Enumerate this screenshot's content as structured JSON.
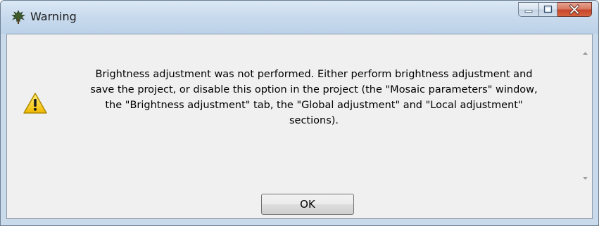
{
  "window": {
    "title": "Warning",
    "app_icon": "tree-icon"
  },
  "caption_buttons": {
    "minimize_icon": "minimize-icon",
    "maximize_icon": "maximize-icon",
    "close_icon": "close-icon"
  },
  "dialog": {
    "icon": "warning-icon",
    "message": "Brightness adjustment was not performed. Either perform brightness adjustment and\nsave the project, or disable this option in the project (the \"Mosaic parameters\" window,\nthe \"Brightness adjustment\" tab, the \"Global adjustment\" and \"Local adjustment\"\nsections).",
    "ok_label": "OK"
  },
  "colors": {
    "client_background": "#f0f0f0",
    "close_button": "#c7452c",
    "warning_yellow": "#f5d21c"
  }
}
